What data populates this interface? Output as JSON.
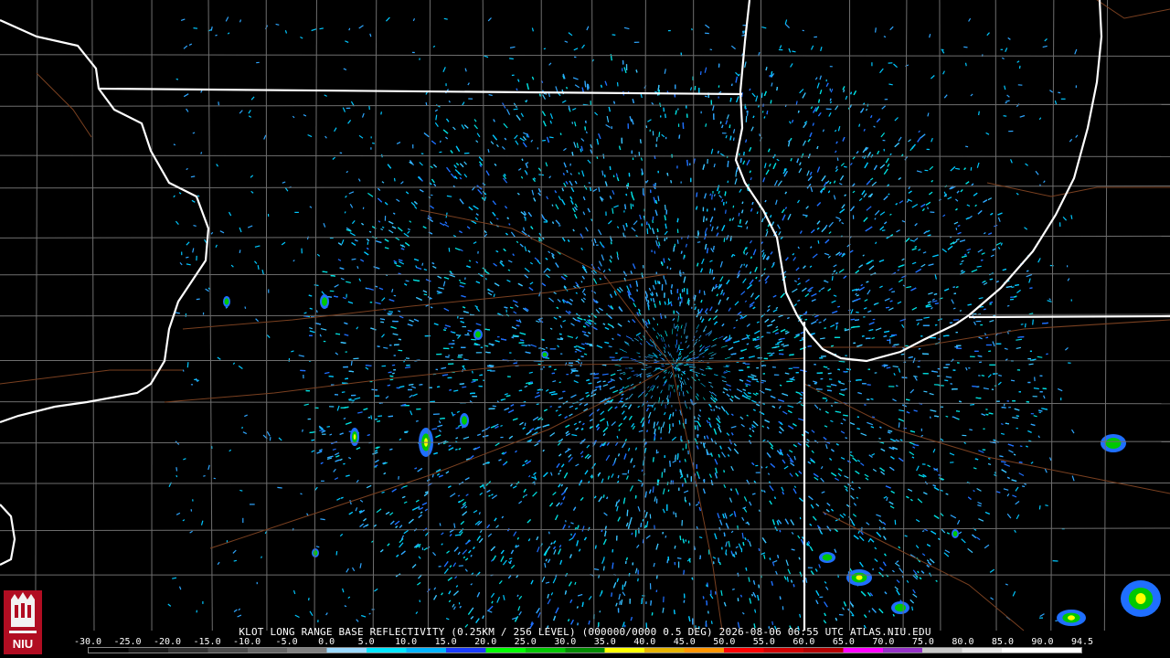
{
  "map": {
    "caption": "KLOT LONG RANGE BASE REFLECTIVITY (0.25KM / 256 LEVEL) (000000/0000 0.5 DEG) 2026-08-06 06:55 UTC  ATLAS.NIU.EDU",
    "radar_site": "KLOT",
    "product": "LONG RANGE BASE REFLECTIVITY",
    "datetime": "2026-08-06 06:55 UTC",
    "logo_text": "NIU",
    "scale_labels": [
      "-30.0",
      "-25.0",
      "-20.0",
      "-15.0",
      "-10.0",
      "-5.0",
      "0.0",
      "5.0",
      "10.0",
      "15.0",
      "20.0",
      "25.0",
      "30.0",
      "35.0",
      "40.0",
      "45.0",
      "50.0",
      "55.0",
      "60.0",
      "65.0",
      "70.0",
      "75.0",
      "80.0",
      "85.0",
      "90.0",
      "94.5"
    ],
    "scale_colors": [
      "#000000",
      "#1a1a1a",
      "#333333",
      "#4d4d4d",
      "#666666",
      "#808080",
      "#9ad9ff",
      "#00e6ff",
      "#00b4ff",
      "#1a3cff",
      "#00ff00",
      "#00c800",
      "#008c00",
      "#ffff00",
      "#e6b400",
      "#ff9600",
      "#ff0000",
      "#d20000",
      "#b40000",
      "#ff00ff",
      "#9632c8",
      "#c8c8c8",
      "#e6e6e6",
      "#ffffff",
      "#ffffff"
    ],
    "background_color": "#000000",
    "state_border_color": "#ffffff",
    "county_line_color": "#6e6e6e",
    "road_color": "#7a4020",
    "echo_colors": [
      "#00c8ff",
      "#2ea6ff",
      "#1f6fff",
      "#00e0e0",
      "#39c4ff"
    ]
  }
}
